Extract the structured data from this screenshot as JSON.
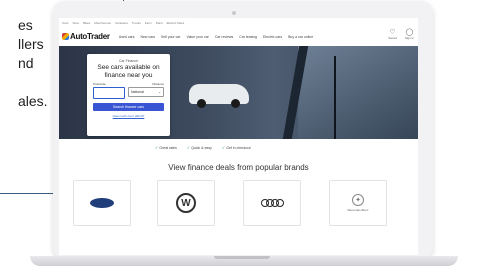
{
  "marketing_text": {
    "line1": "es",
    "line2": "llers",
    "line3": "nd",
    "line4": "ales."
  },
  "site": {
    "util_links": [
      "Cars",
      "Vans",
      "Bikes",
      "Motorhomes",
      "Caravans",
      "Trucks",
      "Farm",
      "Plant",
      "Electric bikes"
    ],
    "logo": "AutoTrader",
    "nav": [
      "Used cars",
      "New cars",
      "Sell your car",
      "Value your car",
      "Car reviews",
      "Car leasing",
      "Electric cars",
      "Buy a car online"
    ],
    "saved_label": "Saved",
    "signin_label": "Sign in"
  },
  "finance_card": {
    "eyebrow": "Car Finance",
    "headline": "See cars available on finance near you",
    "postcode_label": "Postcode",
    "distance_label": "Distance",
    "distance_value": "National",
    "search_button": "Search finance cars",
    "link_text": "How much can I afford?"
  },
  "benefits": [
    "Great rates",
    "Quick & easy",
    "Get in checkout"
  ],
  "brands": {
    "heading": "View finance deals from popular brands",
    "mercedes_label": "Mercedes-Benz"
  },
  "colors": {
    "accent": "#3a55d3",
    "rule": "#3d5a80"
  }
}
